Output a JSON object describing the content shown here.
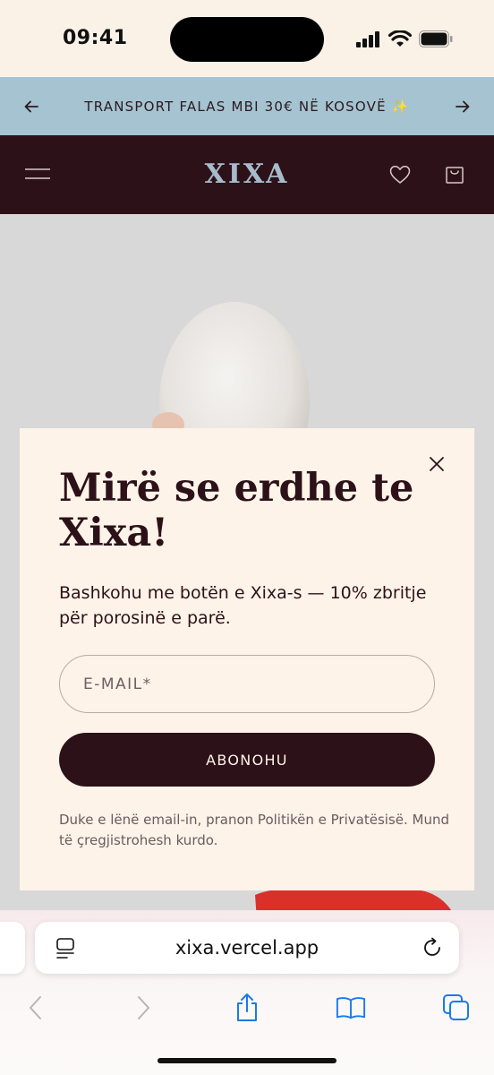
{
  "status_bar": {
    "time": "09:41"
  },
  "announcement": {
    "text": "TRANSPORT FALAS MBI 30€ NË KOSOVË ✨"
  },
  "header": {
    "logo": "XIXA"
  },
  "popup": {
    "title": "Mirë se erdhe te Xixa!",
    "subtitle": "Bashkohu me botën e Xixa-s — 10% zbritje për porosinë e parë.",
    "email_placeholder": "E-MAIL*",
    "subscribe_label": "ABONOHU",
    "legal": "Duke e lënë email-in, pranon Politikën e Privatësisë. Mund të çregjistrohesh kurdo."
  },
  "safari": {
    "address": "xixa.vercel.app"
  },
  "colors": {
    "brand_dark": "#2d1119",
    "announce_bg": "#a5c3d0",
    "cream": "#fdf3e8",
    "ios_blue": "#1a7ae8"
  }
}
